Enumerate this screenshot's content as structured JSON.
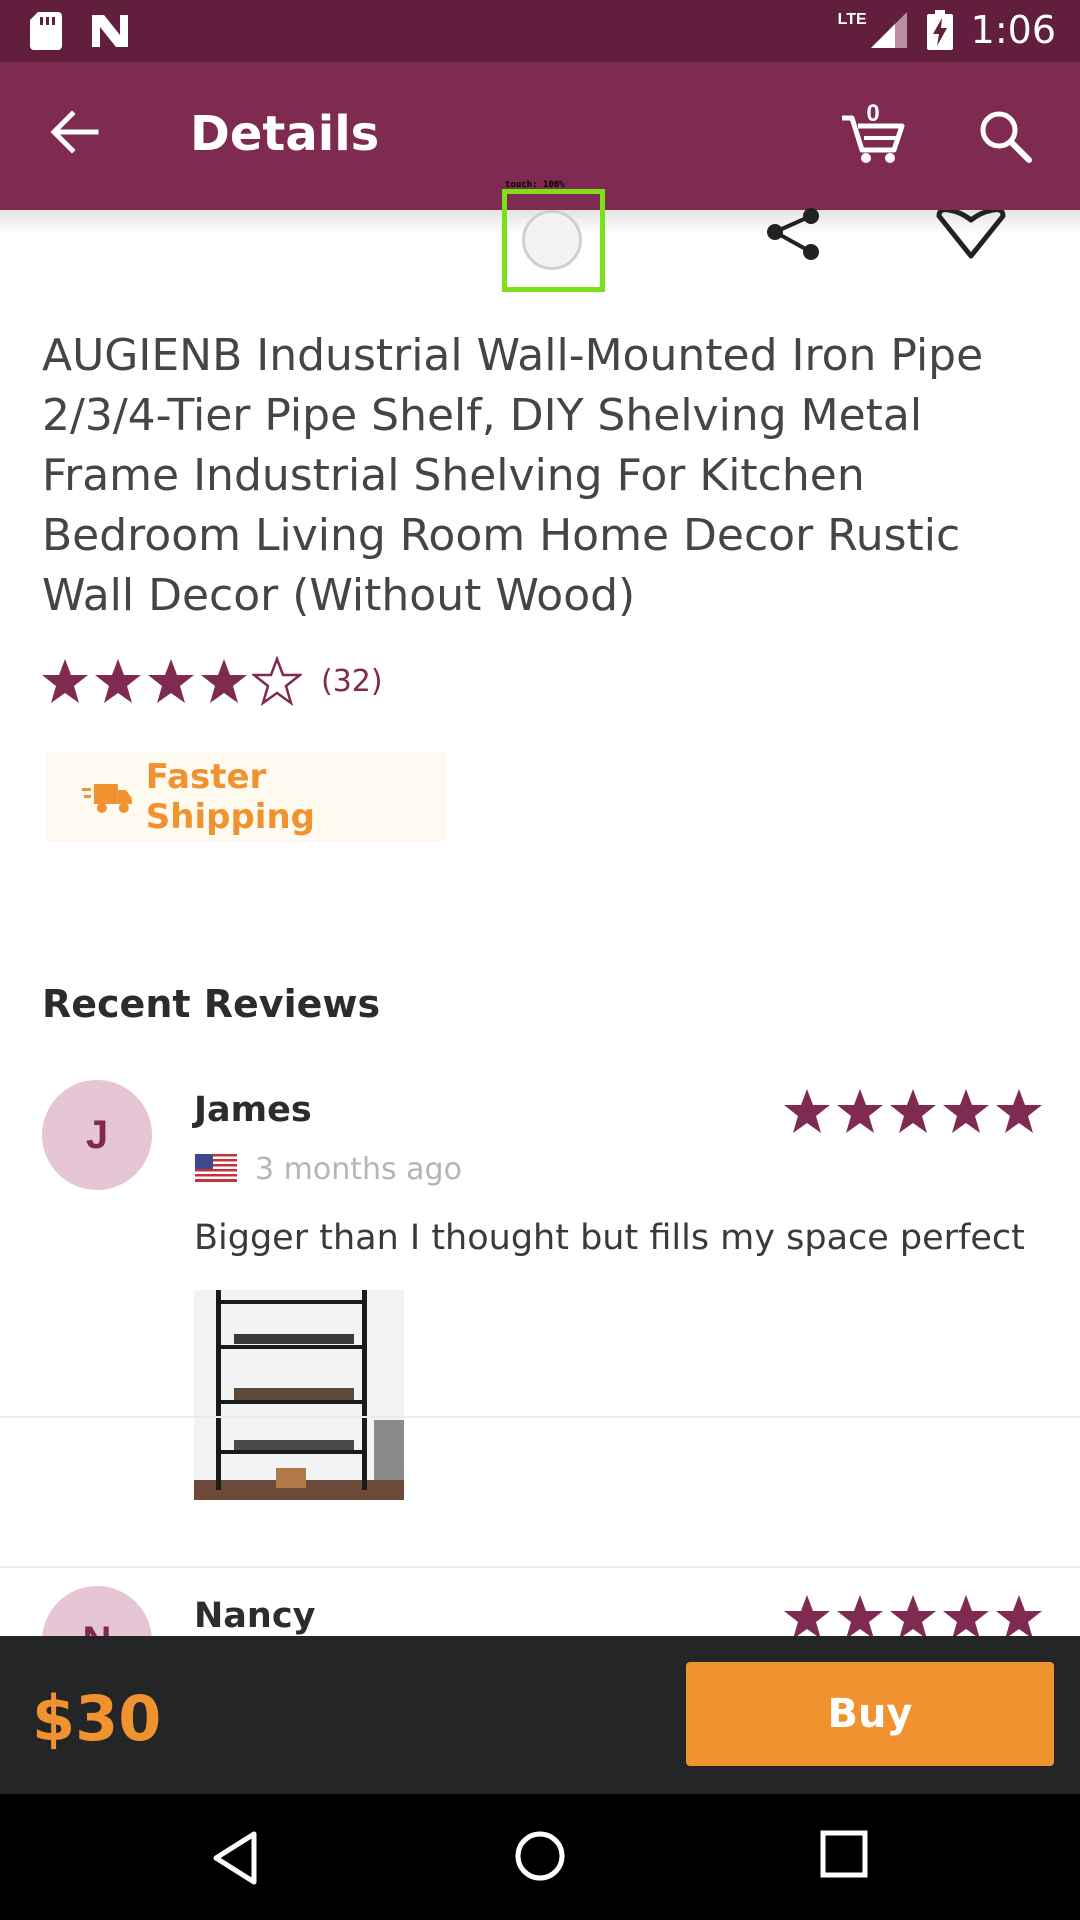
{
  "status_bar": {
    "time": "1:06",
    "network": "LTE",
    "icons": [
      "sd-card-icon",
      "n-icon",
      "signal-icon",
      "battery-charging-icon"
    ]
  },
  "app_bar": {
    "title": "Details",
    "cart_count": "0",
    "icons": [
      "back-arrow-icon",
      "cart-icon",
      "search-icon"
    ]
  },
  "overlay": {
    "touch_label": "touch: 100%"
  },
  "product": {
    "title": "AUGIENB Industrial Wall-Mounted Iron Pipe 2/3/4-Tier Pipe Shelf, DIY Shelving Metal Frame Industrial Shelving For Kitchen Bedroom Living Room Home Decor Rustic Wall Decor (Without Wood)",
    "rating": 4,
    "rating_max": 5,
    "rating_count": "(32)",
    "shipping_badge": "Faster Shipping"
  },
  "reviews": {
    "section_title": "Recent Reviews",
    "items": [
      {
        "initial": "J",
        "name": "James",
        "date": "3 months ago",
        "stars": 5,
        "text": "Bigger than I thought but fills my space perfect"
      },
      {
        "initial": "N",
        "name": "Nancy",
        "stars": 5
      }
    ]
  },
  "buy_bar": {
    "price": "$30",
    "buy_label": "Buy"
  },
  "colors": {
    "status_bar": "#611e3d",
    "app_bar": "#7e2a51",
    "accent": "#f0922f",
    "star": "#7e2a51",
    "buy_bar": "#232526"
  }
}
